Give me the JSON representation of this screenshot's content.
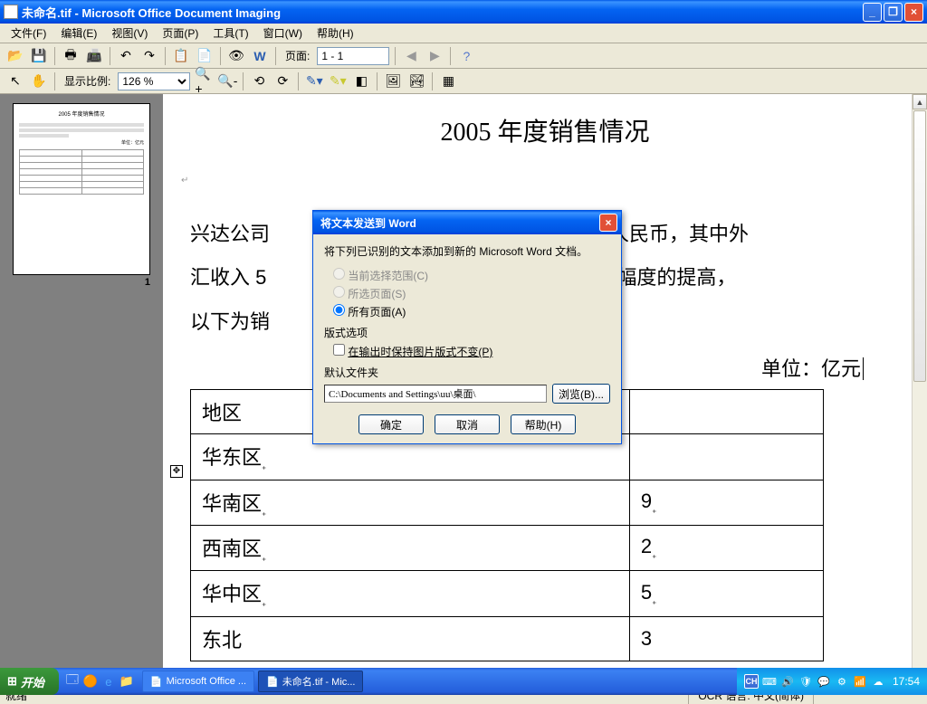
{
  "window": {
    "title": "未命名.tif - Microsoft Office Document Imaging"
  },
  "menu": {
    "file": "文件(F)",
    "edit": "编辑(E)",
    "view": "视图(V)",
    "page": "页面(P)",
    "tools": "工具(T)",
    "window": "窗口(W)",
    "help": "帮助(H)"
  },
  "toolbar1": {
    "page_label": "页面:",
    "page_value": "1 - 1"
  },
  "toolbar2": {
    "zoom_label": "显示比例:",
    "zoom_value": "126 %"
  },
  "thumbnail": {
    "pagenum": "1"
  },
  "document": {
    "title": "2005 年度销售情况",
    "para_l1_pre": "兴达公司",
    "para_l1_post": "亿元人民币，其中外",
    "para_l2_pre": "汇收入 5",
    "para_l2_post": "有了大幅度的提高，",
    "para_l3": "以下为销",
    "unit": "单位：亿元",
    "table": {
      "h1": "地区",
      "h2": "",
      "rows": [
        {
          "c1": "华东区",
          "c2": ""
        },
        {
          "c1": "华南区",
          "c2": "9"
        },
        {
          "c1": "西南区",
          "c2": "2"
        },
        {
          "c1": "华中区",
          "c2": "5"
        },
        {
          "c1": "东北",
          "c2": "3"
        }
      ]
    }
  },
  "dialog": {
    "title": "将文本发送到 Word",
    "instruction": "将下列已识别的文本添加到新的 Microsoft Word 文档。",
    "radio1": "当前选择范围(C)",
    "radio2": "所选页面(S)",
    "radio3": "所有页面(A)",
    "layout_label": "版式选项",
    "checkbox1": "在输出时保持图片版式不变(P)",
    "folder_label": "默认文件夹",
    "path": "C:\\Documents and Settings\\uu\\桌面\\",
    "browse": "浏览(B)...",
    "ok": "确定",
    "cancel": "取消",
    "help": "帮助(H)"
  },
  "status": {
    "ready": "就绪",
    "ocr": "OCR 语言: 中文(简体)"
  },
  "taskbar": {
    "start": "开始",
    "task1": "Microsoft Office ...",
    "task2": "未命名.tif - Mic...",
    "lang": "CH",
    "clock": "17:54"
  }
}
